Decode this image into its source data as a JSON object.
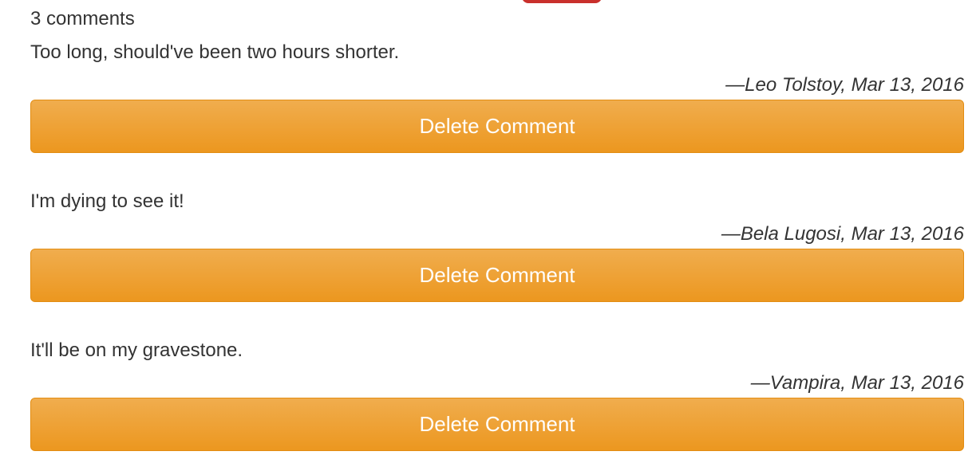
{
  "comments_header": {
    "count_label": "3 comments"
  },
  "comments": [
    {
      "text": "Too long, should've been two hours shorter.",
      "meta": "—Leo Tolstoy, Mar 13, 2016",
      "delete_label": "Delete Comment"
    },
    {
      "text": "I'm dying to see it!",
      "meta": "—Bela Lugosi, Mar 13, 2016",
      "delete_label": "Delete Comment"
    },
    {
      "text": "It'll be on my gravestone.",
      "meta": "—Vampira, Mar 13, 2016",
      "delete_label": "Delete Comment"
    }
  ],
  "colors": {
    "delete_button": "#f0ad4e",
    "delete_button_border": "#e38d13",
    "top_button": "#c9302c"
  }
}
